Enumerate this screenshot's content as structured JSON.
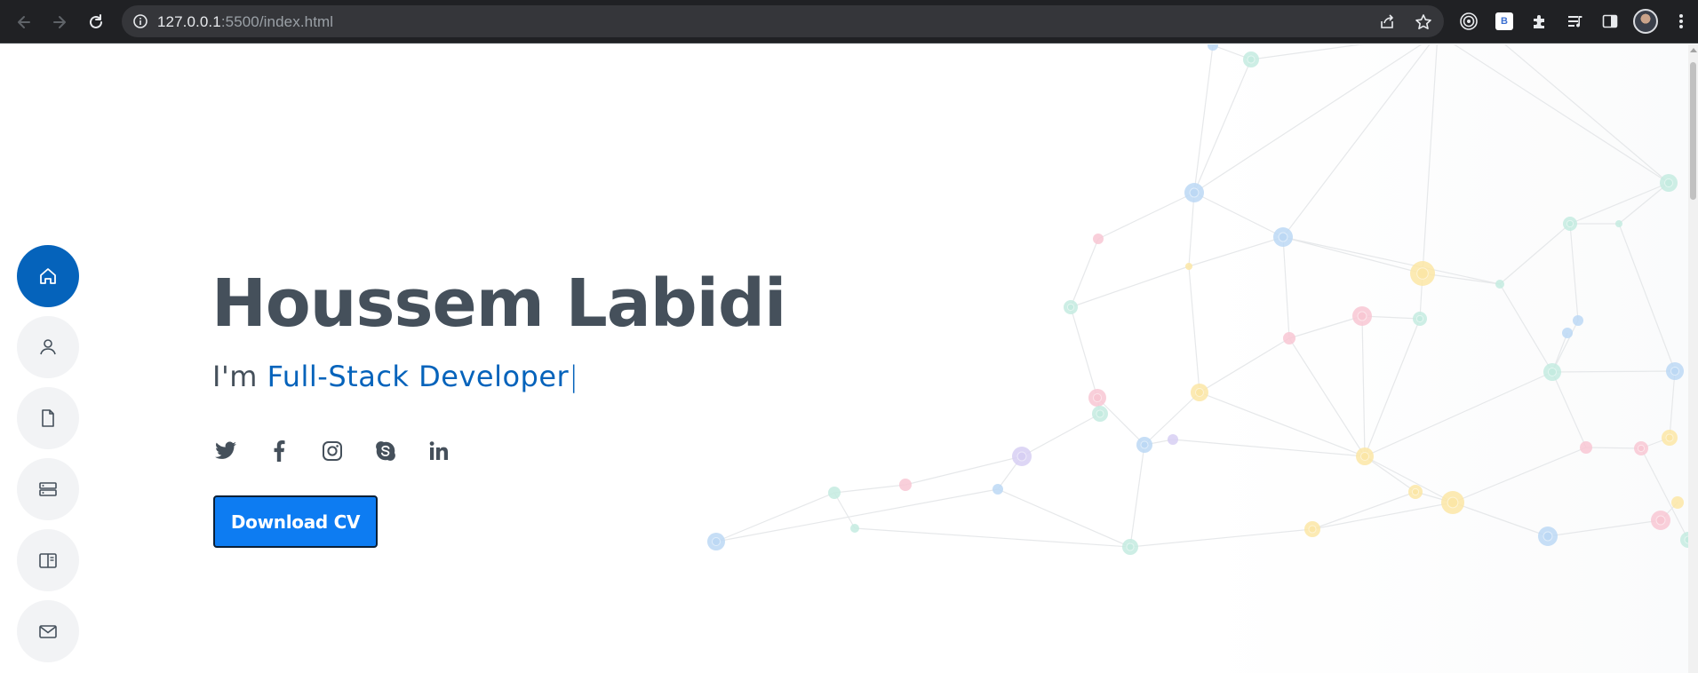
{
  "browser": {
    "url_host": "127.0.0.1",
    "url_rest": ":5500/index.html",
    "extension_badge": "B"
  },
  "sidenav": {
    "items": [
      {
        "name": "home",
        "icon": "home-icon",
        "active": true
      },
      {
        "name": "about",
        "icon": "person-icon",
        "active": false
      },
      {
        "name": "resume",
        "icon": "file-icon",
        "active": false
      },
      {
        "name": "services",
        "icon": "server-icon",
        "active": false
      },
      {
        "name": "portfolio",
        "icon": "book-icon",
        "active": false
      },
      {
        "name": "contact",
        "icon": "envelope-icon",
        "active": false
      }
    ]
  },
  "hero": {
    "name": "Houssem Labidi",
    "prefix": "I'm ",
    "role": "Full-Stack Developer",
    "cursor": "|",
    "cv_button": "Download CV"
  },
  "socials": [
    "twitter-icon",
    "facebook-icon",
    "instagram-icon",
    "skype-icon",
    "linkedin-icon"
  ],
  "colors": {
    "accent": "#0563bb",
    "text": "#45505b",
    "button": "#0d7cf2",
    "nav_bg": "#f2f3f5"
  }
}
